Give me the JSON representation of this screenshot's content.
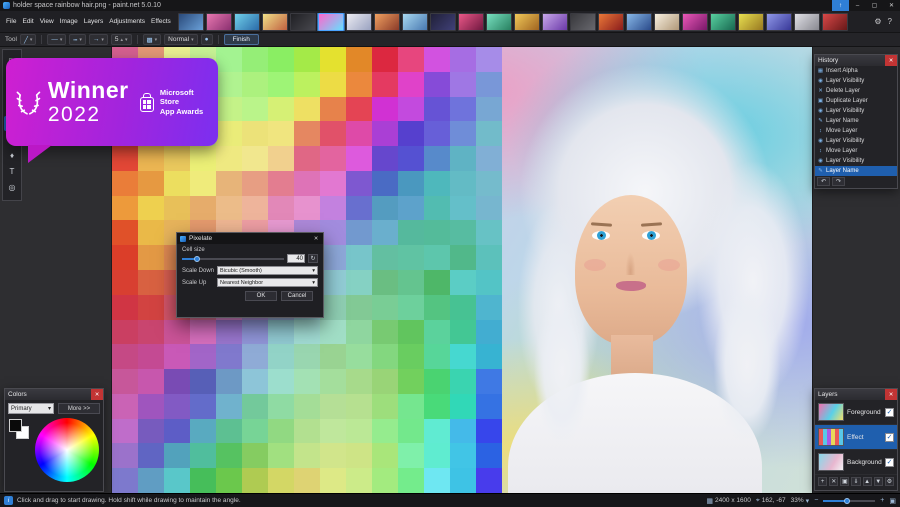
{
  "window": {
    "title": "holder space rainbow hair.png - paint.net 5.0.10"
  },
  "menus": [
    "File",
    "Edit",
    "View",
    "Image",
    "Layers",
    "Adjustments",
    "Effects"
  ],
  "icons": {
    "minimize": "–",
    "maximize": "▢",
    "close": "✕",
    "update": "↑",
    "gear": "⚙",
    "help": "?",
    "dropdown": "▾",
    "up": "▴",
    "info": "i",
    "undo": "↶",
    "redo": "↷",
    "reset": "↻",
    "line": "╱",
    "cap": "—",
    "dash": "┅",
    "arrow": "→",
    "fill": "▩",
    "antialias": "●",
    "check": "✓",
    "size": "▦",
    "cursor": "⌖",
    "zoom_out": "−",
    "zoom_in": "+",
    "fit": "▣"
  },
  "toolbar": {
    "tool_label": "Tool",
    "width_value": "5",
    "blend_mode": "Normal",
    "finish_label": "Finish"
  },
  "thumbnails": {
    "active_index": 5,
    "items": [
      [
        "#2a4a7a",
        "#6aa0d8"
      ],
      [
        "#e878b0",
        "#8a3070"
      ],
      [
        "#70d0ea",
        "#2a6aa8"
      ],
      [
        "#f0e088",
        "#c06040"
      ],
      [
        "#202024",
        "#48484e"
      ],
      [
        "#ff66cc",
        "#66e0ff"
      ],
      [
        "#ececf2",
        "#9aa2c0"
      ],
      [
        "#f0a060",
        "#8a3a28"
      ],
      [
        "#a8d8f0",
        "#4878b0"
      ],
      [
        "#202038",
        "#404078"
      ],
      [
        "#ea5888",
        "#701840"
      ],
      [
        "#78e0c0",
        "#288060"
      ],
      [
        "#f0c858",
        "#a06420"
      ],
      [
        "#c8a8ea",
        "#6a38a8"
      ],
      [
        "#38383c",
        "#68686e"
      ],
      [
        "#ea7838",
        "#8a1c1c"
      ],
      [
        "#88b8e8",
        "#2a4a8a"
      ],
      [
        "#f8f0e0",
        "#b09878"
      ],
      [
        "#ea58b8",
        "#781868"
      ],
      [
        "#58d0a0",
        "#186850"
      ],
      [
        "#e8e050",
        "#987820"
      ],
      [
        "#9098e8",
        "#383898"
      ],
      [
        "#e0e0e6",
        "#888890"
      ],
      [
        "#d84848",
        "#681818"
      ]
    ]
  },
  "tools": {
    "items": [
      {
        "name": "rectangle-select",
        "glyph": "▭"
      },
      {
        "name": "lasso-select",
        "glyph": "◌"
      },
      {
        "name": "magic-wand",
        "glyph": "✱"
      },
      {
        "name": "move-selection",
        "glyph": "✚"
      },
      {
        "name": "paintbrush",
        "glyph": "✎"
      },
      {
        "name": "eraser",
        "glyph": "▱"
      },
      {
        "name": "clone-stamp",
        "glyph": "♦"
      },
      {
        "name": "text",
        "glyph": "T"
      },
      {
        "name": "color-picker",
        "glyph": "◎"
      }
    ]
  },
  "badge": {
    "line1": "Winner",
    "line2": "2022",
    "store_line1": "Microsoft Store",
    "store_line2": "App Awards"
  },
  "dialog": {
    "title": "Pixelate",
    "cell_size_label": "Cell size",
    "cell_size_value": "40",
    "scale_down_label": "Scale Down",
    "scale_down_value": "Bicubic (Smooth)",
    "scale_up_label": "Scale Up",
    "scale_up_value": "Nearest Neighbor",
    "ok": "OK",
    "cancel": "Cancel"
  },
  "history": {
    "title": "History",
    "selected_index": 10,
    "items": [
      {
        "icon": "insert",
        "label": "Insert Alpha"
      },
      {
        "icon": "visibility",
        "label": "Layer Visibility"
      },
      {
        "icon": "delete",
        "label": "Delete Layer"
      },
      {
        "icon": "duplicate",
        "label": "Duplicate Layer"
      },
      {
        "icon": "visibility",
        "label": "Layer Visibility"
      },
      {
        "icon": "name",
        "label": "Layer Name"
      },
      {
        "icon": "move",
        "label": "Move Layer"
      },
      {
        "icon": "visibility",
        "label": "Layer Visibility"
      },
      {
        "icon": "move",
        "label": "Move Layer"
      },
      {
        "icon": "visibility",
        "label": "Layer Visibility"
      },
      {
        "icon": "name",
        "label": "Layer Name"
      }
    ]
  },
  "history_icons": {
    "insert": "▦",
    "visibility": "◉",
    "delete": "✕",
    "duplicate": "▣",
    "name": "✎",
    "move": "↕"
  },
  "layers": {
    "title": "Layers",
    "items": [
      {
        "name": "Foreground",
        "visible": true,
        "selected": false
      },
      {
        "name": "Effect",
        "visible": true,
        "selected": true
      },
      {
        "name": "Background",
        "visible": true,
        "selected": false
      }
    ]
  },
  "layer_actions": [
    {
      "name": "add-layer",
      "glyph": "+"
    },
    {
      "name": "delete-layer",
      "glyph": "✕"
    },
    {
      "name": "duplicate-layer",
      "glyph": "▣"
    },
    {
      "name": "merge-layer-down",
      "glyph": "⇓"
    },
    {
      "name": "move-layer-up",
      "glyph": "▲"
    },
    {
      "name": "move-layer-down",
      "glyph": "▼"
    },
    {
      "name": "layer-properties",
      "glyph": "⚙"
    }
  ],
  "colors": {
    "title": "Colors",
    "mode": "Primary",
    "more_label": "More >>"
  },
  "status": {
    "message": "Click and drag to start drawing. Hold shift while drawing to maintain the angle.",
    "image_size": "2400 x 1600",
    "cursor_pos": "162, -67",
    "zoom": "33%"
  }
}
